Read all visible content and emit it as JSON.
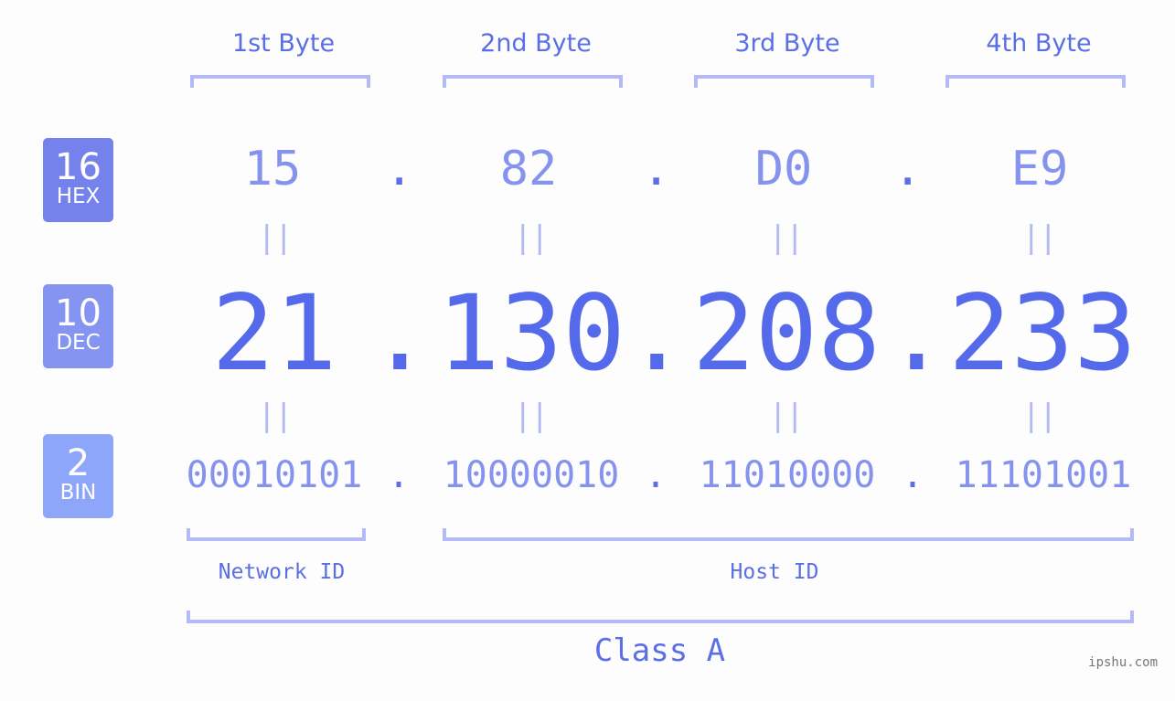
{
  "byte_headers": [
    "1st Byte",
    "2nd Byte",
    "3rd Byte",
    "4th Byte"
  ],
  "rows": {
    "hex": {
      "base": "16",
      "label": "HEX",
      "color": "#7682ec",
      "values": [
        "15",
        "82",
        "D0",
        "E9"
      ]
    },
    "dec": {
      "base": "10",
      "label": "DEC",
      "color": "#8593f1",
      "values": [
        "21",
        "130",
        "208",
        "233"
      ]
    },
    "bin": {
      "base": "2",
      "label": "BIN",
      "color": "#8ea6f9",
      "values": [
        "00010101",
        "10000010",
        "11010000",
        "11101001"
      ]
    }
  },
  "separator": ".",
  "equals_sign": "||",
  "network_id_label": "Network ID",
  "host_id_label": "Host ID",
  "class_label": "Class A",
  "watermark": "ipshu.com",
  "colors": {
    "accent": "#546aea",
    "light_accent": "#8592ee",
    "bracket": "#b3baf5",
    "background": "#fcfdfc"
  }
}
